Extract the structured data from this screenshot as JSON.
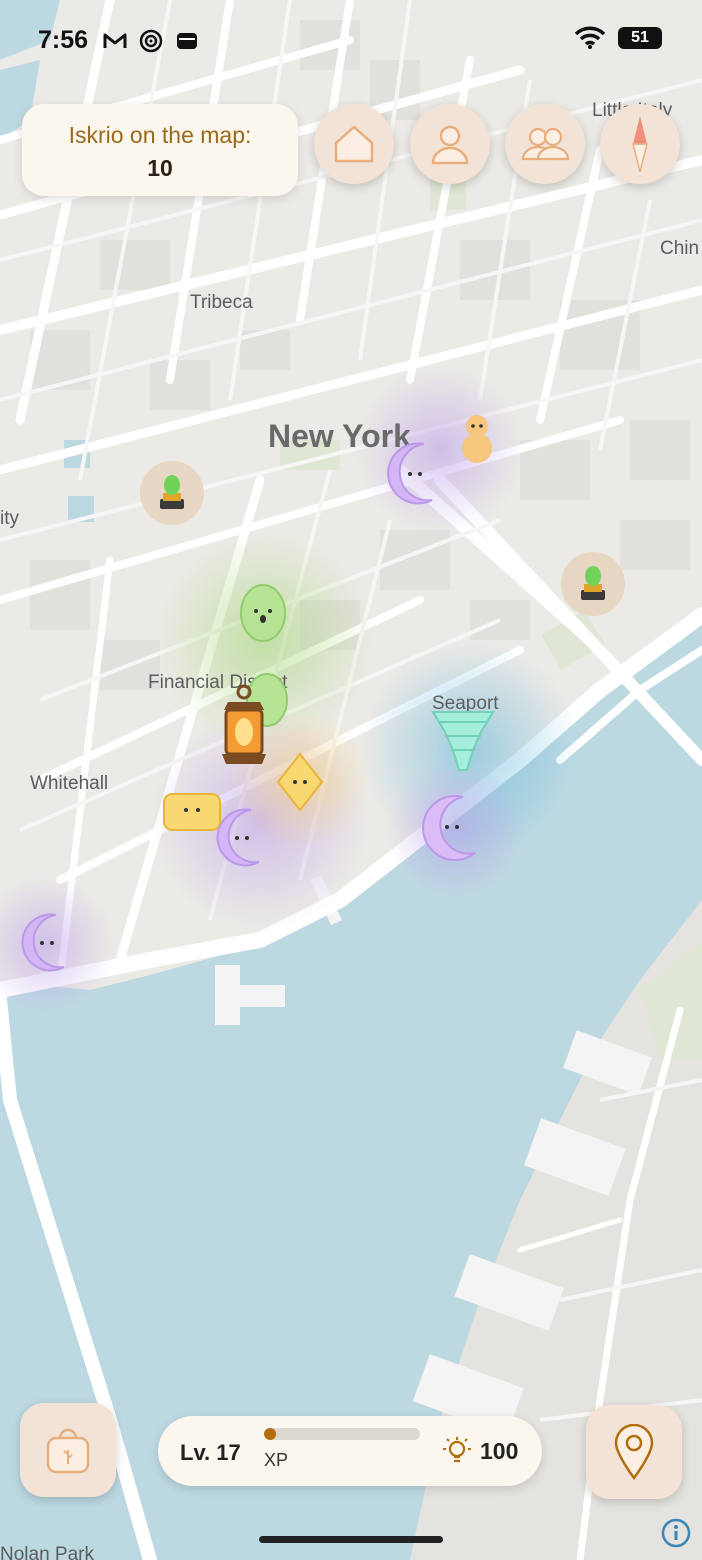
{
  "status_bar": {
    "time": "7:56",
    "battery_level": "51",
    "left_icons": [
      "gmail-icon",
      "spiral-app-icon",
      "wallet-icon"
    ],
    "right_icons": [
      "wifi-icon",
      "battery-icon"
    ]
  },
  "counter": {
    "label": "Iskrio on the map:",
    "value": "10"
  },
  "top_buttons": [
    {
      "name": "home-button",
      "icon": "house-icon"
    },
    {
      "name": "profile-button",
      "icon": "person-icon"
    },
    {
      "name": "friends-button",
      "icon": "people-icon"
    },
    {
      "name": "compass-button",
      "icon": "compass-icon"
    }
  ],
  "map_labels": {
    "city": "New York",
    "tribeca": "Tribeca",
    "financial_district": "Financial District",
    "seaport": "Seaport",
    "whitehall": "Whitehall",
    "little_italy": "Little Italy",
    "china": "Chin",
    "city_left": "ity",
    "nolan_park": "Nolan Park"
  },
  "map_creatures": [
    {
      "kind": "lantern-pedestal",
      "color": "#c8a978"
    },
    {
      "kind": "lantern-pedestal",
      "color": "#c8a978"
    },
    {
      "kind": "moon-spirit",
      "color": "#c9a4ef"
    },
    {
      "kind": "gourd-spirit",
      "color": "#f4c27a"
    },
    {
      "kind": "egg-spirit",
      "color": "#a9dc86"
    },
    {
      "kind": "egg-spirit",
      "color": "#a9dc86"
    },
    {
      "kind": "tornado-spirit",
      "color": "#88ddc8"
    },
    {
      "kind": "moon-spirit",
      "color": "#c9a4ef"
    },
    {
      "kind": "crystal-spirit",
      "color": "#f6cc55"
    },
    {
      "kind": "gem-spirit",
      "color": "#f6cc55"
    },
    {
      "kind": "moon-spirit",
      "color": "#c9a4ef"
    },
    {
      "kind": "moon-spirit",
      "color": "#c9a4ef"
    },
    {
      "kind": "player-lantern",
      "color": "#d9741f"
    }
  ],
  "player": {
    "level_label": "Lv. 17",
    "xp_label": "XP",
    "xp_progress": 0.08,
    "coins": "100"
  },
  "bottom_buttons": [
    {
      "name": "bag-button",
      "icon": "bag-icon"
    },
    {
      "name": "location-button",
      "icon": "location-pin-icon"
    }
  ],
  "colors": {
    "water": "#bcd9e2",
    "land": "#eceae6",
    "road": "#ffffff",
    "button_bg": "#f3e3d6",
    "card_bg": "#fbf6ee",
    "accent": "#9b6a1a",
    "xp_fill": "#b06e0c"
  }
}
